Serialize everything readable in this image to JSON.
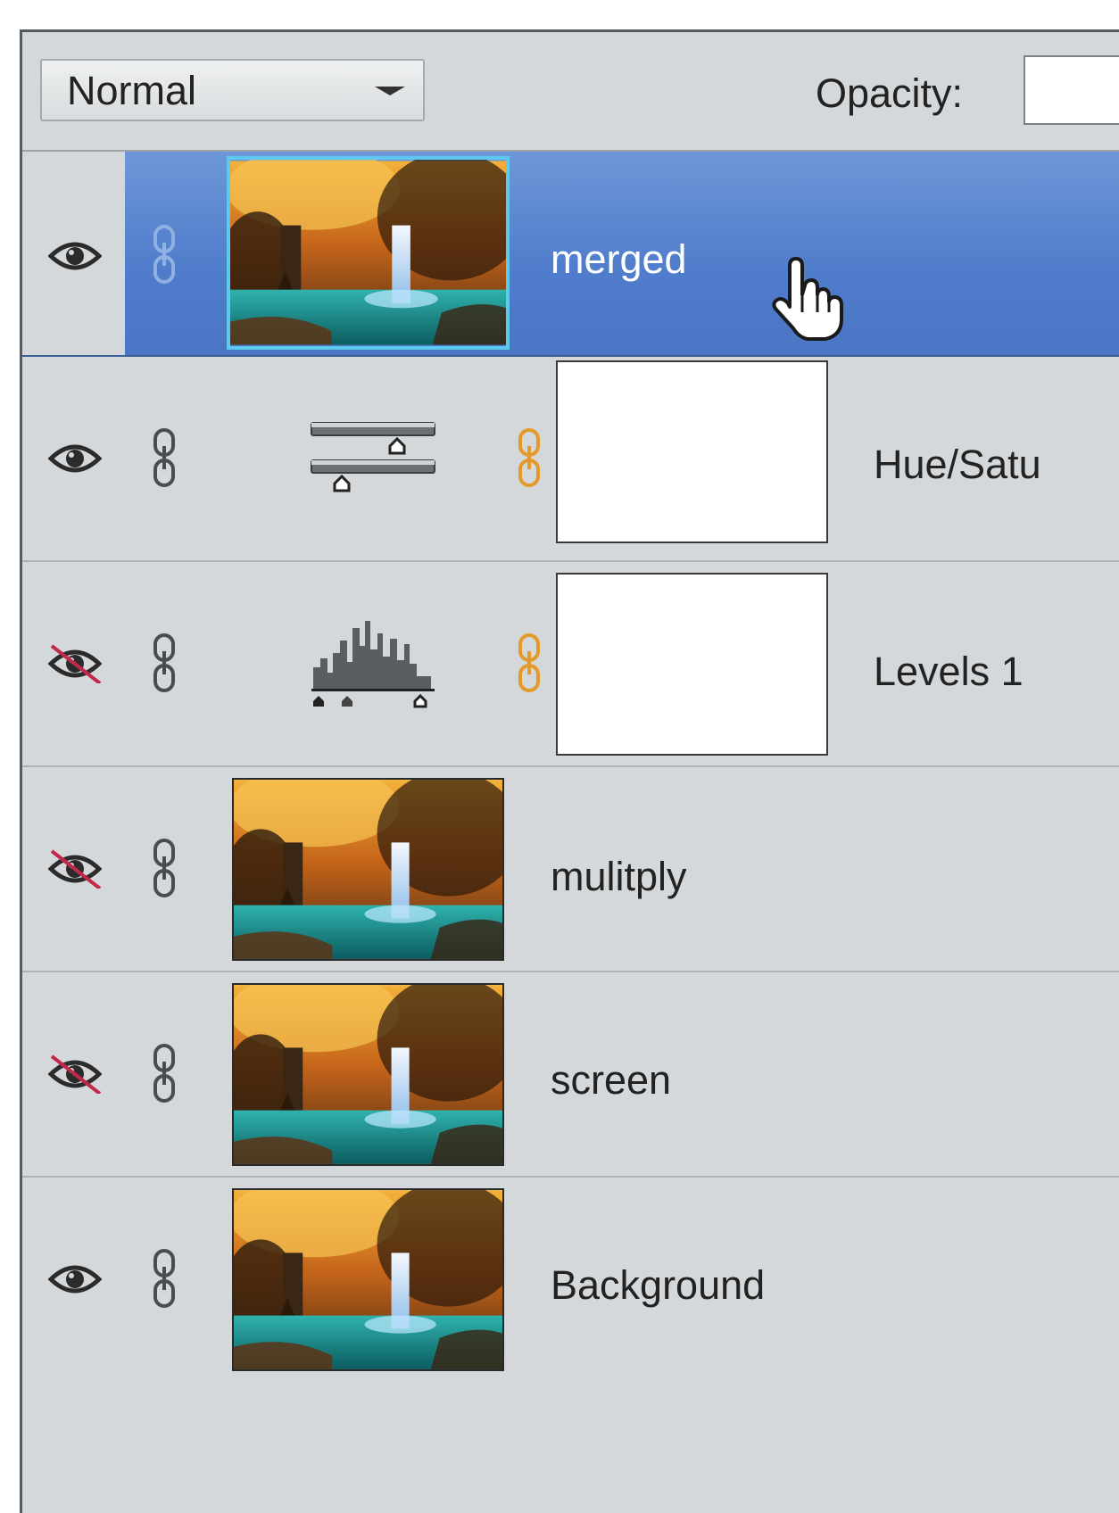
{
  "toolbar": {
    "blend_mode": "Normal",
    "opacity_label": "Opacity:"
  },
  "layers": [
    {
      "name": "merged",
      "visible": true,
      "selected": true,
      "type": "image",
      "icon": "eye-icon"
    },
    {
      "name": "Hue/Satu",
      "visible": true,
      "selected": false,
      "type": "hue-saturation-adjustment",
      "icon": "eye-icon"
    },
    {
      "name": "Levels 1",
      "visible": false,
      "selected": false,
      "type": "levels-adjustment",
      "icon": "eye-hidden-icon"
    },
    {
      "name": "mulitply",
      "visible": false,
      "selected": false,
      "type": "image",
      "icon": "eye-hidden-icon"
    },
    {
      "name": "screen",
      "visible": false,
      "selected": false,
      "type": "image",
      "icon": "eye-hidden-icon"
    },
    {
      "name": "Background",
      "visible": true,
      "selected": false,
      "type": "image",
      "icon": "eye-icon"
    }
  ],
  "colors": {
    "selection": "#5383cf",
    "selected_thumb_border": "#5ec9ef",
    "mask_link": "#e39a2a",
    "hidden_slash": "#c2284a"
  }
}
